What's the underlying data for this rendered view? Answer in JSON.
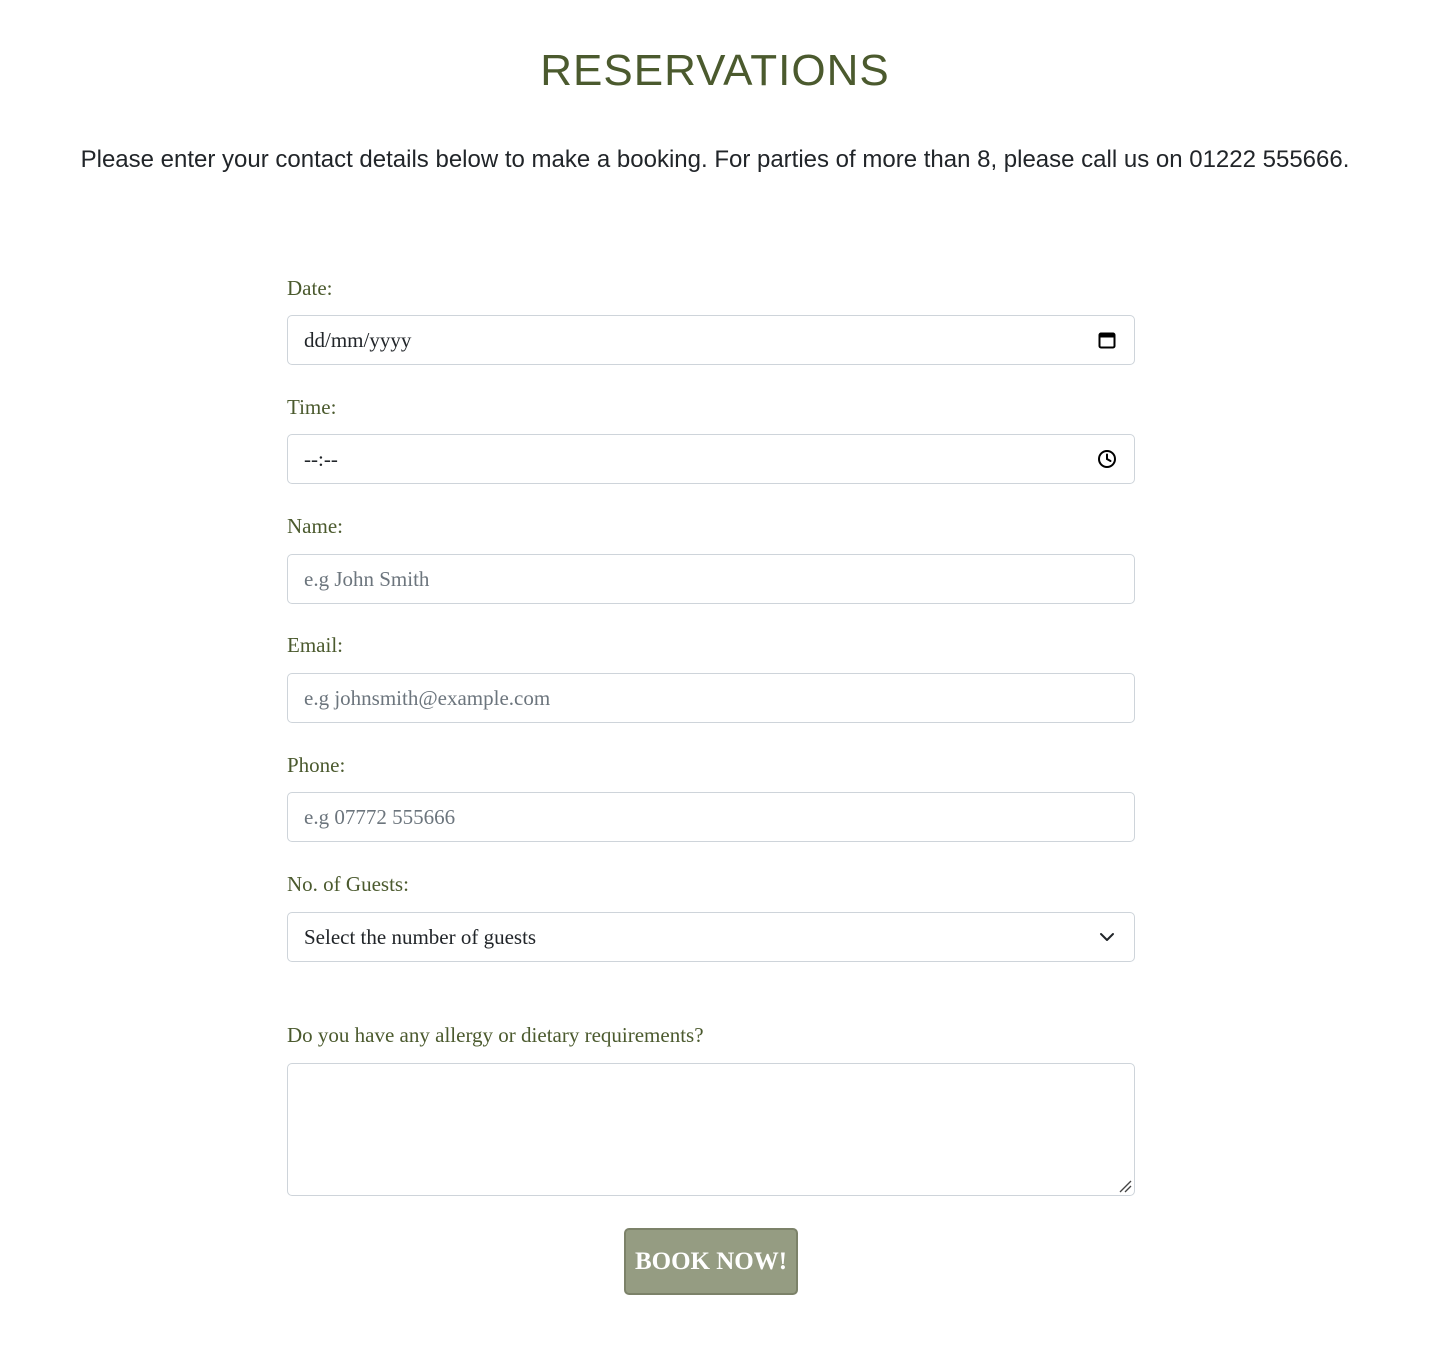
{
  "header": {
    "title": "RESERVATIONS",
    "intro": "Please enter your contact details below to make a booking. For parties of more than 8, please call us on 01222 555666."
  },
  "form": {
    "date": {
      "label": "Date:",
      "value": "dd/mm/yyyy",
      "icon": "calendar-icon"
    },
    "time": {
      "label": "Time:",
      "value": "--:--",
      "icon": "clock-icon"
    },
    "name": {
      "label": "Name:",
      "placeholder": "e.g John Smith"
    },
    "email": {
      "label": "Email:",
      "placeholder": "e.g johnsmith@example.com"
    },
    "phone": {
      "label": "Phone:",
      "placeholder": "e.g 07772 555666"
    },
    "guests": {
      "label": "No. of Guests:",
      "selected": "Select the number of guests",
      "icon": "chevron-down-icon"
    },
    "dietary": {
      "label": "Do you have any allergy or dietary requirements?",
      "value": ""
    },
    "submit_label": "BOOK NOW!"
  },
  "colors": {
    "accent": "#4b5a2e",
    "button_bg": "#959c82",
    "border": "#ced4da"
  }
}
